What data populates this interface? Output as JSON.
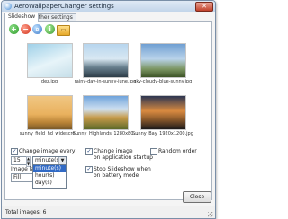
{
  "window": {
    "title": "AeroWallpaperChanger settings",
    "close_symbol": "✕"
  },
  "tabs": [
    {
      "label": "Slideshow",
      "active": true
    },
    {
      "label": "Other settings",
      "active": false
    }
  ],
  "toolbar": {
    "icons": [
      "add-icon",
      "remove-icon",
      "search-icon",
      "info-icon",
      "folder-icon"
    ],
    "add_symbol": "+",
    "remove_symbol": "−",
    "search_symbol": "⌕",
    "info_symbol": "i",
    "folder_symbol": "▭"
  },
  "thumbnails": [
    {
      "caption": "dez.jpg"
    },
    {
      "caption": "rainy-day-in-sunny-june.jpg"
    },
    {
      "caption": "sky-cloudy-blue-sunny.jpg"
    },
    {
      "caption": "sunny_field_hd_widescre..."
    },
    {
      "caption": "Sunny_Highlands_1280x80..."
    },
    {
      "caption": "Sunny_Bay_1920x1200.jpg"
    }
  ],
  "options": {
    "change_every_label": "Change image every",
    "change_every_checked": true,
    "interval_value": "15",
    "interval_unit_selected": "minute(s)",
    "interval_unit_options": [
      "minute(s)",
      "hour(s)",
      "day(s)"
    ],
    "change_startup_label_1": "Change image",
    "change_startup_label_2": "on application startup",
    "change_startup_checked": true,
    "random_label": "Random order",
    "random_checked": false,
    "stop_battery_label_1": "Stop Slideshow when",
    "stop_battery_label_2": "on battery mode",
    "stop_battery_checked": true,
    "layout_label": "Image layout",
    "layout_value": "Fill",
    "check_mark": "✓"
  },
  "buttons": {
    "close_label": "Close"
  },
  "status": {
    "total_text": "Total images: 6"
  },
  "colors": {
    "selection": "#316ac5",
    "window_border": "#7a8fa8"
  }
}
